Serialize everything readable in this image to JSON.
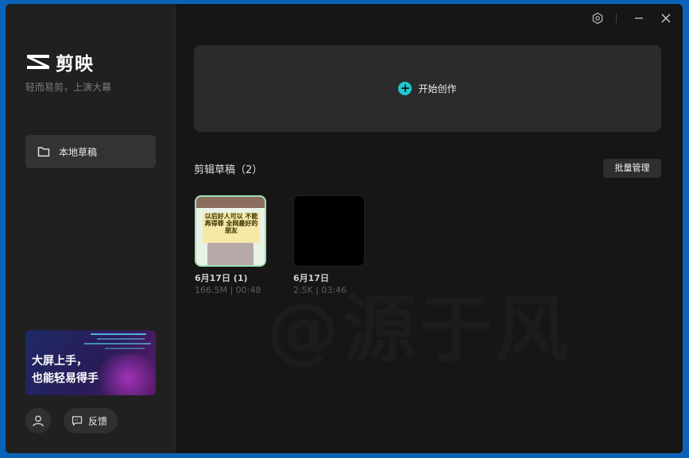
{
  "app": {
    "logo_text": "剪映",
    "slogan": "轻而易剪，上演大幕"
  },
  "sidebar": {
    "nav_items": [
      {
        "label": "本地草稿",
        "icon": "folder-icon",
        "active": true
      }
    ],
    "promo": {
      "line1": "大屏上手，",
      "line2": "也能轻易得手"
    },
    "feedback_label": "反馈"
  },
  "window_controls": [
    "settings-icon",
    "minimize-icon",
    "close-icon"
  ],
  "main": {
    "create_label": "开始创作",
    "drafts_title": "剪辑草稿（2）",
    "batch_manage_label": "批量管理",
    "drafts": [
      {
        "name": "6月17日 (1)",
        "meta": "166.5M | 00:48",
        "thumb_text": "以后好人可以 不能再得罪 全网最好的朋友"
      },
      {
        "name": "6月17日",
        "meta": "2.5K | 03:46"
      }
    ],
    "watermark": "@源于风"
  },
  "colors": {
    "frame_blue": "#0a63b8",
    "accent_teal": "#1ec8d2",
    "sidebar_bg": "#202020",
    "main_bg": "#161616"
  }
}
